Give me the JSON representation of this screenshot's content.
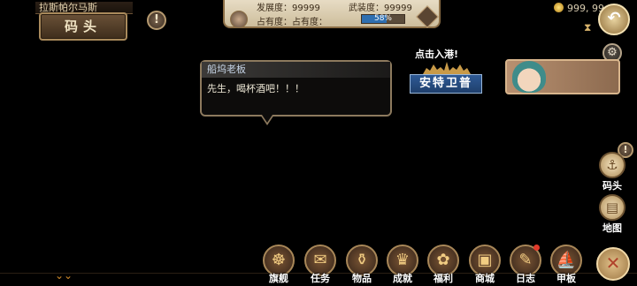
{
  "location": {
    "subtitle": "拉斯帕尔马斯",
    "name": "码头"
  },
  "stats": {
    "development_label": "发展度：",
    "development_value": "99999",
    "armament_label": "武装度：",
    "armament_value": "99999",
    "occupation_label": "占有度：",
    "occupation_name": "占有度：",
    "occupation_percent": "58%",
    "occupation_fraction": 0.58
  },
  "gold": {
    "amount": "999, 99"
  },
  "dialog": {
    "speaker": "船坞老板",
    "text": "先生，喝杯酒吧！！！"
  },
  "port": {
    "hint": "点击入港!",
    "name": "安特卫普"
  },
  "side": {
    "dock_label": "码头",
    "map_label": "地图"
  },
  "bottom_nav": {
    "items": [
      {
        "label": "旗舰",
        "icon": "ship-wheel-icon",
        "glyph": "☸"
      },
      {
        "label": "任务",
        "icon": "scroll-icon",
        "glyph": "✉"
      },
      {
        "label": "物品",
        "icon": "treasure-bag-icon",
        "glyph": "⚱"
      },
      {
        "label": "成就",
        "icon": "trophy-icon",
        "glyph": "♛"
      },
      {
        "label": "福利",
        "icon": "gift-bag-icon",
        "glyph": "✿"
      },
      {
        "label": "商城",
        "icon": "treasure-chest-icon",
        "glyph": "▣"
      },
      {
        "label": "日志",
        "icon": "journal-icon",
        "glyph": "✎"
      },
      {
        "label": "甲板",
        "icon": "sailing-ship-icon",
        "glyph": "⛵"
      }
    ]
  },
  "colors": {
    "accent": "#a88758",
    "occupation_bar": "#2f6fb0",
    "port_tag": "#2e5a95"
  }
}
